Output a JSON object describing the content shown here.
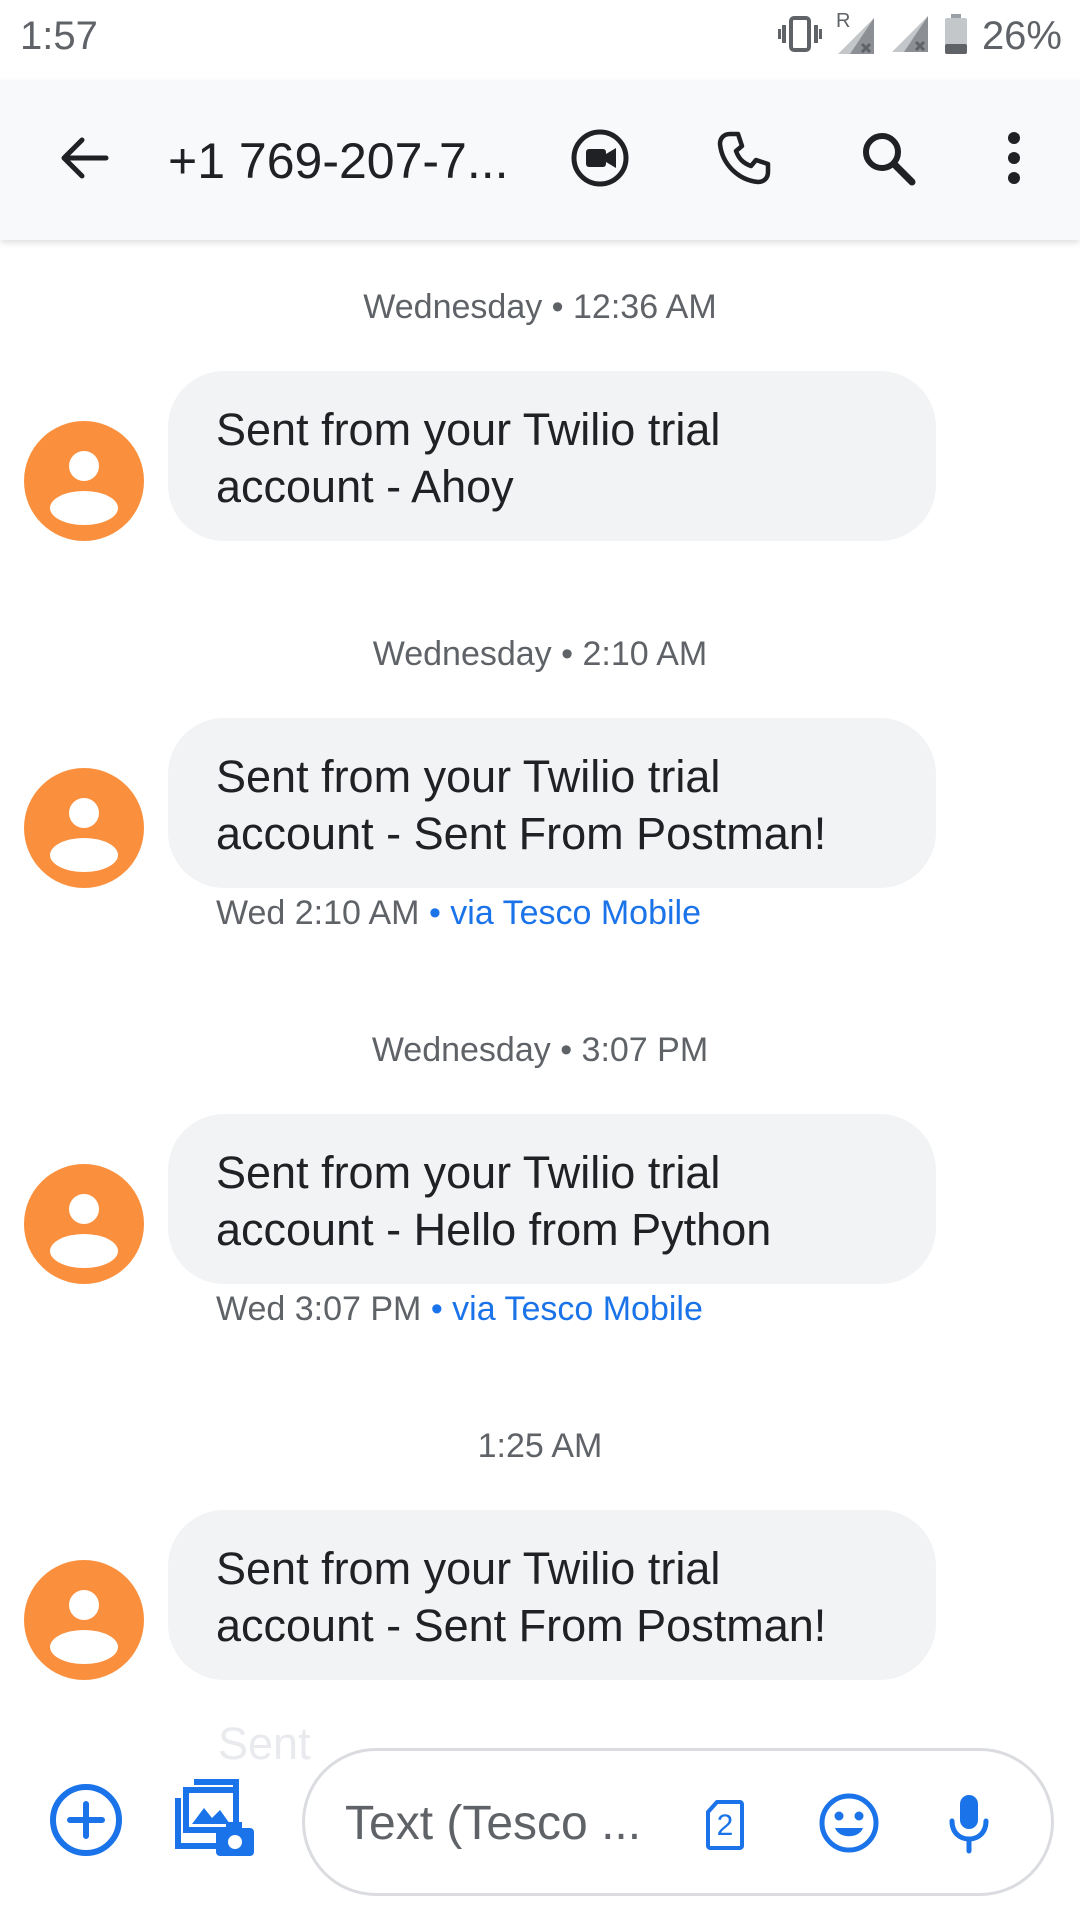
{
  "status_bar": {
    "time": "1:57",
    "battery": "26%",
    "roaming_indicator": "R",
    "icons": [
      "vibrate-icon",
      "signal-roaming-icon",
      "signal-icon",
      "battery-icon"
    ]
  },
  "app_bar": {
    "title": "+1 769-207-7...",
    "icons": [
      "back-arrow-icon",
      "video-call-icon",
      "phone-icon",
      "search-icon",
      "more-vert-icon"
    ]
  },
  "conversation": {
    "messages": [
      {
        "timestamp": "Wednesday • 12:36 AM",
        "text": "Sent from your Twilio trial account - Ahoy",
        "meta_time": "",
        "meta_carrier": ""
      },
      {
        "timestamp": "Wednesday • 2:10 AM",
        "text": "Sent from your Twilio trial account - Sent From Postman!",
        "meta_time": "Wed 2:10 AM",
        "meta_carrier": "• via Tesco Mobile"
      },
      {
        "timestamp": "Wednesday • 3:07 PM",
        "text": "Sent from your Twilio trial account - Hello from Python",
        "meta_time": "Wed 3:07 PM",
        "meta_carrier": "• via Tesco Mobile"
      },
      {
        "timestamp": "1:25 AM",
        "text": "Sent from your Twilio trial account - Sent From Postman!",
        "meta_time": "",
        "meta_carrier": ""
      }
    ],
    "peek_text": "Sent"
  },
  "compose": {
    "placeholder": "Text (Tesco ...",
    "sim_number": "2",
    "icons": [
      "add-icon",
      "gallery-camera-icon",
      "sim-icon",
      "emoji-icon",
      "mic-icon"
    ]
  },
  "colors": {
    "avatar": "#fa903e",
    "bubble": "#f1f3f4",
    "accent": "#1a73e8",
    "appbar": "#f8f9fa"
  }
}
